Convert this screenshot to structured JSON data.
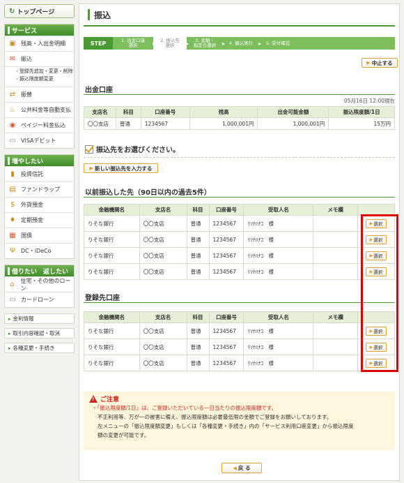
{
  "sidebar": {
    "top_page": "トップページ",
    "service_head": "サービス",
    "service_items": [
      "残高・入出金明細",
      "振込"
    ],
    "sub_items": [
      "登録先追加・変更・削除",
      "振込限度額変更"
    ],
    "service_items2": [
      "振替",
      "公共料金等自動支払",
      "ペイジー料金払込",
      "VISAデビット"
    ],
    "grow_head": "増やしたい",
    "grow_items": [
      "投資信託",
      "ファンドラップ",
      "外貨預金",
      "定期預金",
      "国債",
      "DC・iDeCo"
    ],
    "borrow_head": "借りたい　返したい",
    "borrow_items": [
      "住宅・その他のローン",
      "カードローン"
    ],
    "bottom_buttons": [
      "金利情報",
      "取引内容確認・取消",
      "各種変更・手続き"
    ]
  },
  "page_title": "振込",
  "steps": {
    "label": "STEP",
    "items": [
      {
        "l1": "1. 出金口座",
        "l2": "選択"
      },
      {
        "l1": "2. 振込先",
        "l2": "選択"
      },
      {
        "l1": "3. 金額・",
        "l2": "指定日選択"
      },
      {
        "l1": "4. 振込実行",
        "l2": ""
      },
      {
        "l1": "5. 受付確認",
        "l2": ""
      }
    ]
  },
  "stop_button": "中止する",
  "withdraw": {
    "title": "出金口座",
    "date": "05月16日 12:00現在",
    "headers": [
      "支店名",
      "科目",
      "口座番号",
      "残高",
      "出金可能金額",
      "振込限度額/1日"
    ],
    "row": [
      "〇〇支店",
      "普通",
      "1234567",
      "1,000,001円",
      "1,000,001円",
      "15万円"
    ]
  },
  "select_heading": "振込先をお選びください。",
  "new_payee_button": "新しい振込先を入力する",
  "recent": {
    "title": "以前振込した先（90日以内の過去5件）",
    "headers": [
      "金融機関名",
      "支店名",
      "科目",
      "口座番号",
      "受取人名",
      "メモ欄",
      ""
    ],
    "rows": [
      [
        "りそな銀行",
        "〇〇支店",
        "普通",
        "1234567",
        "ﾘｿﾅﾊﾅｺ　様",
        ""
      ],
      [
        "りそな銀行",
        "〇〇支店",
        "普通",
        "1234567",
        "ﾘｿﾅﾊﾅｺ　様",
        ""
      ],
      [
        "りそな銀行",
        "〇〇支店",
        "普通",
        "1234567",
        "ﾘｿﾅﾊﾅｺ　様",
        ""
      ],
      [
        "りそな銀行",
        "〇〇支店",
        "普通",
        "1234567",
        "ﾘｿﾅﾊﾅｺ　様",
        ""
      ]
    ],
    "select_label": "選択"
  },
  "registered": {
    "title": "登録先口座",
    "headers": [
      "金融機関名",
      "支店名",
      "科目",
      "口座番号",
      "受取人名",
      "メモ欄",
      ""
    ],
    "rows": [
      [
        "りそな銀行",
        "〇〇支店",
        "普通",
        "1234567",
        "ﾘｿﾅﾊﾅｺ　様",
        ""
      ],
      [
        "りそな銀行",
        "〇〇支店",
        "普通",
        "1234567",
        "ﾘｿﾅﾊﾅｺ　様",
        ""
      ],
      [
        "りそな銀行",
        "〇〇支店",
        "普通",
        "1234567",
        "ﾘｿﾅﾊﾅｺ　様",
        ""
      ]
    ],
    "select_label": "選択"
  },
  "notice": {
    "title": "ご注意",
    "line1": "・「振込限度額/1日」は、ご登録いただいている一日当たりの振込限度額です。",
    "line2": "不正利用等、万が一の被害に備え、振込限度額は必要最低限の金額でご登録をお願いしております。",
    "line3": "左メニューの「振込限度額変更」もしくは「各種変更・手続き」内の「サービス利用口座変更」から振込限度",
    "line4": "額の変更が可能です。"
  },
  "back_button": "戻 る",
  "colors": {
    "brand_green": "#4e9a34",
    "accent_orange": "#e39a20",
    "highlight_red": "#e00000"
  }
}
